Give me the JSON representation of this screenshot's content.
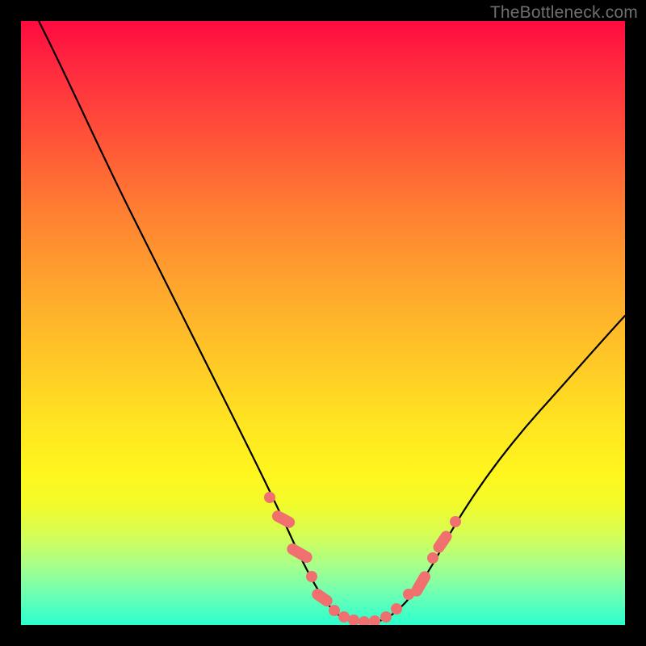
{
  "watermark": "TheBottleneck.com",
  "chart_data": {
    "type": "line",
    "title": "",
    "xlabel": "",
    "ylabel": "",
    "xlim": [
      0,
      100
    ],
    "ylim": [
      0,
      100
    ],
    "grid": false,
    "legend": false,
    "series": [
      {
        "name": "bottleneck-curve",
        "x": [
          3,
          8,
          13,
          18,
          23,
          28,
          33,
          38,
          41,
          44,
          47,
          50,
          53,
          56,
          58,
          61,
          65,
          70,
          75,
          80,
          85,
          90,
          95,
          100
        ],
        "y": [
          100,
          90,
          79,
          68,
          57,
          46,
          35,
          25,
          19,
          13,
          8,
          4,
          2,
          1,
          1,
          2,
          5,
          11,
          19,
          28,
          37,
          45,
          52,
          58
        ]
      }
    ],
    "markers": {
      "name": "highlight-points",
      "x": [
        41,
        43,
        46,
        48,
        50,
        52,
        54,
        56,
        58,
        60,
        62,
        64,
        66,
        67,
        69
      ],
      "y": [
        19,
        15,
        10,
        7,
        4,
        2.5,
        1.5,
        1,
        1,
        2,
        4,
        7,
        10,
        12,
        16
      ]
    },
    "colors": {
      "gradient_top": "#ff0a40",
      "gradient_mid": "#ffe322",
      "gradient_bottom": "#2bffce",
      "curve": "#000000",
      "marker": "#f07070",
      "frame": "#000000"
    }
  }
}
